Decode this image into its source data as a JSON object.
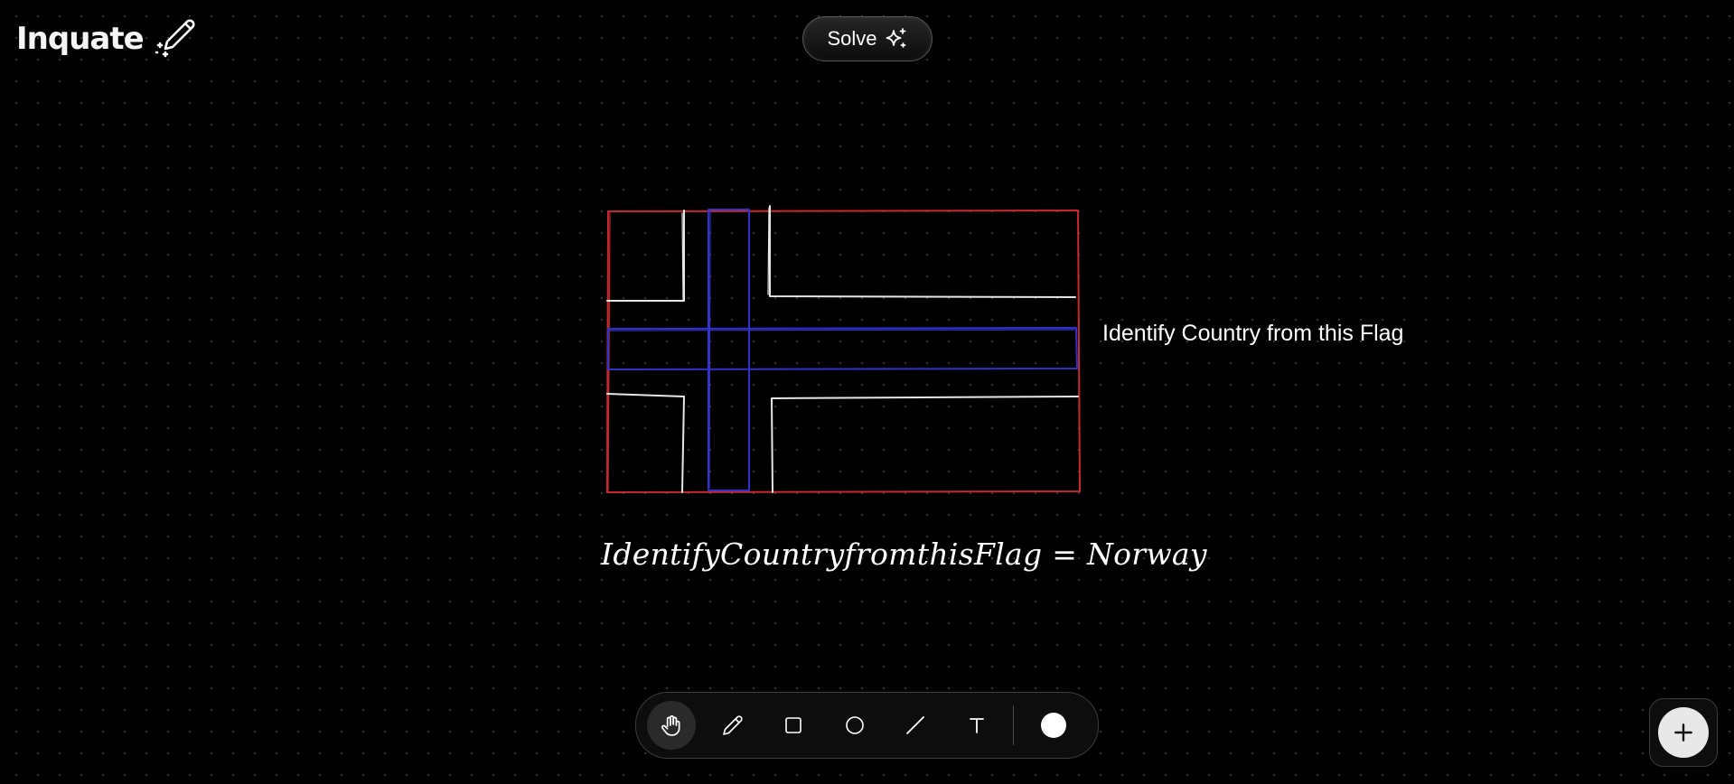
{
  "app": {
    "name": "Inquate"
  },
  "header": {
    "solve_label": "Solve"
  },
  "canvas": {
    "prompt_text": "Identify Country from this Flag",
    "result_text": "IdentifyCountryfromthisFlag = Norway",
    "stroke_colors": {
      "border": "#c8282e",
      "cross_blue": "#3232c8",
      "cross_white": "#e6e6e6"
    }
  },
  "toolbar": {
    "tools": [
      {
        "icon": "hand-icon",
        "label": "Pan",
        "active": true
      },
      {
        "icon": "pencil-icon",
        "label": "Draw",
        "active": false
      },
      {
        "icon": "square-icon",
        "label": "Rectangle",
        "active": false
      },
      {
        "icon": "circle-icon",
        "label": "Ellipse",
        "active": false
      },
      {
        "icon": "line-icon",
        "label": "Line",
        "active": false
      },
      {
        "icon": "text-icon",
        "label": "Text",
        "active": false
      }
    ],
    "current_color": "#ffffff"
  },
  "add_button": {
    "icon": "plus-icon"
  },
  "theme": {
    "background": "#000000",
    "dot_color": "#3a3a3a"
  }
}
